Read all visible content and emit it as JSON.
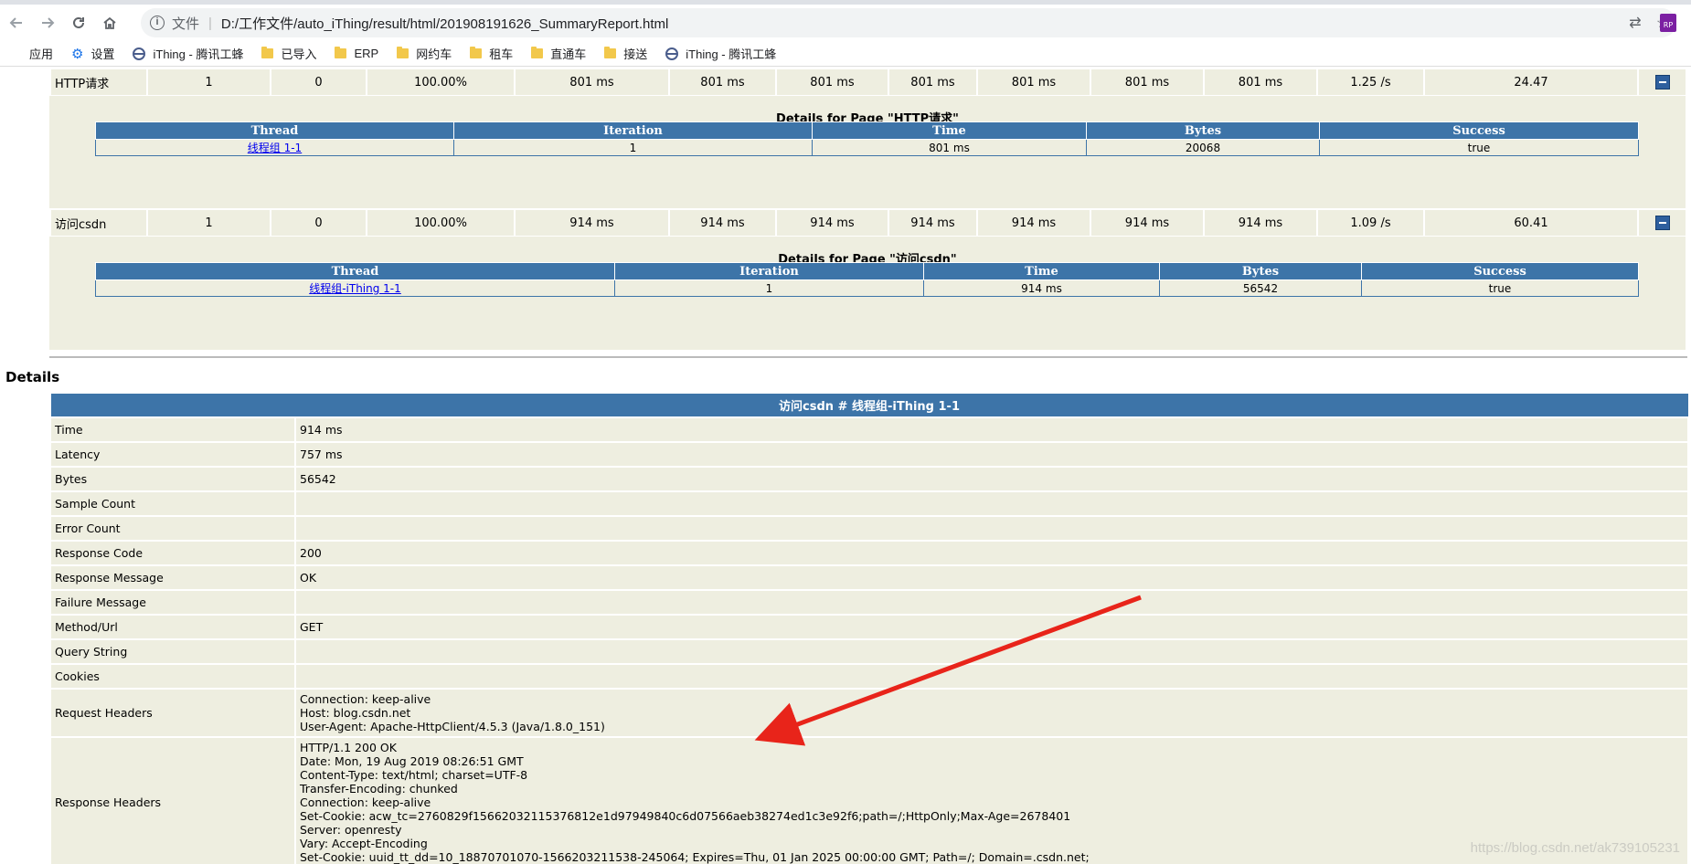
{
  "browser": {
    "url_label": "文件",
    "url": "D:/工作文件/auto_iThing/result/html/201908191626_SummaryReport.html",
    "extension_label": "RP",
    "bookmarks": [
      "应用",
      "设置",
      "iThing - 腾讯工蜂",
      "已导入",
      "ERP",
      "网约车",
      "租车",
      "直通车",
      "接送",
      "iThing - 腾讯工蜂"
    ]
  },
  "pages": [
    {
      "name": "HTTP请求",
      "cols": [
        "1",
        "0",
        "100.00%",
        "801 ms",
        "801 ms",
        "801 ms",
        "801 ms",
        "801 ms",
        "801 ms",
        "801 ms",
        "1.25 /s",
        "24.47"
      ],
      "details_title": "Details for Page \"HTTP请求\"",
      "headers": [
        "Thread",
        "Iteration",
        "Time",
        "Bytes",
        "Success"
      ],
      "row": [
        "线程组 1-1",
        "1",
        "801 ms",
        "20068",
        "true"
      ]
    },
    {
      "name": "访问csdn",
      "cols": [
        "1",
        "0",
        "100.00%",
        "914 ms",
        "914 ms",
        "914 ms",
        "914 ms",
        "914 ms",
        "914 ms",
        "914 ms",
        "1.09 /s",
        "60.41"
      ],
      "details_title": "Details for Page \"访问csdn\"",
      "headers": [
        "Thread",
        "Iteration",
        "Time",
        "Bytes",
        "Success"
      ],
      "row": [
        "线程组-iThing 1-1",
        "1",
        "914 ms",
        "56542",
        "true"
      ]
    }
  ],
  "details": {
    "heading": "Details",
    "table_title": "访问csdn # 线程组-iThing 1-1",
    "rows": [
      {
        "k": "Time",
        "v": "914 ms"
      },
      {
        "k": "Latency",
        "v": "757 ms"
      },
      {
        "k": "Bytes",
        "v": "56542"
      },
      {
        "k": "Sample Count",
        "v": ""
      },
      {
        "k": "Error Count",
        "v": ""
      },
      {
        "k": "Response Code",
        "v": "200"
      },
      {
        "k": "Response Message",
        "v": "OK"
      },
      {
        "k": "Failure Message",
        "v": ""
      },
      {
        "k": "Method/Url",
        "v": "GET"
      },
      {
        "k": "Query String",
        "v": ""
      },
      {
        "k": "Cookies",
        "v": ""
      },
      {
        "k": "Request Headers",
        "v": "Connection: keep-alive\nHost: blog.csdn.net\nUser-Agent: Apache-HttpClient/4.5.3 (Java/1.8.0_151)"
      },
      {
        "k": "Response Headers",
        "v": "HTTP/1.1 200 OK\nDate: Mon, 19 Aug 2019 08:26:51 GMT\nContent-Type: text/html; charset=UTF-8\nTransfer-Encoding: chunked\nConnection: keep-alive\nSet-Cookie: acw_tc=2760829f15662032115376812e1d97949840c6d07566aeb38274ed1c3e92f6;path=/;HttpOnly;Max-Age=2678401\nServer: openresty\nVary: Accept-Encoding\nSet-Cookie: uuid_tt_dd=10_18870701070-1566203211538-245064; Expires=Thu, 01 Jan 2025 00:00:00 GMT; Path=/; Domain=.csdn.net;"
      }
    ]
  },
  "watermark": "https://blog.csdn.net/ak739105231",
  "colors": {
    "header_blue": "#3d74a8",
    "row_bg": "#eeeee0",
    "annotation_arrow": "#e8241a"
  }
}
